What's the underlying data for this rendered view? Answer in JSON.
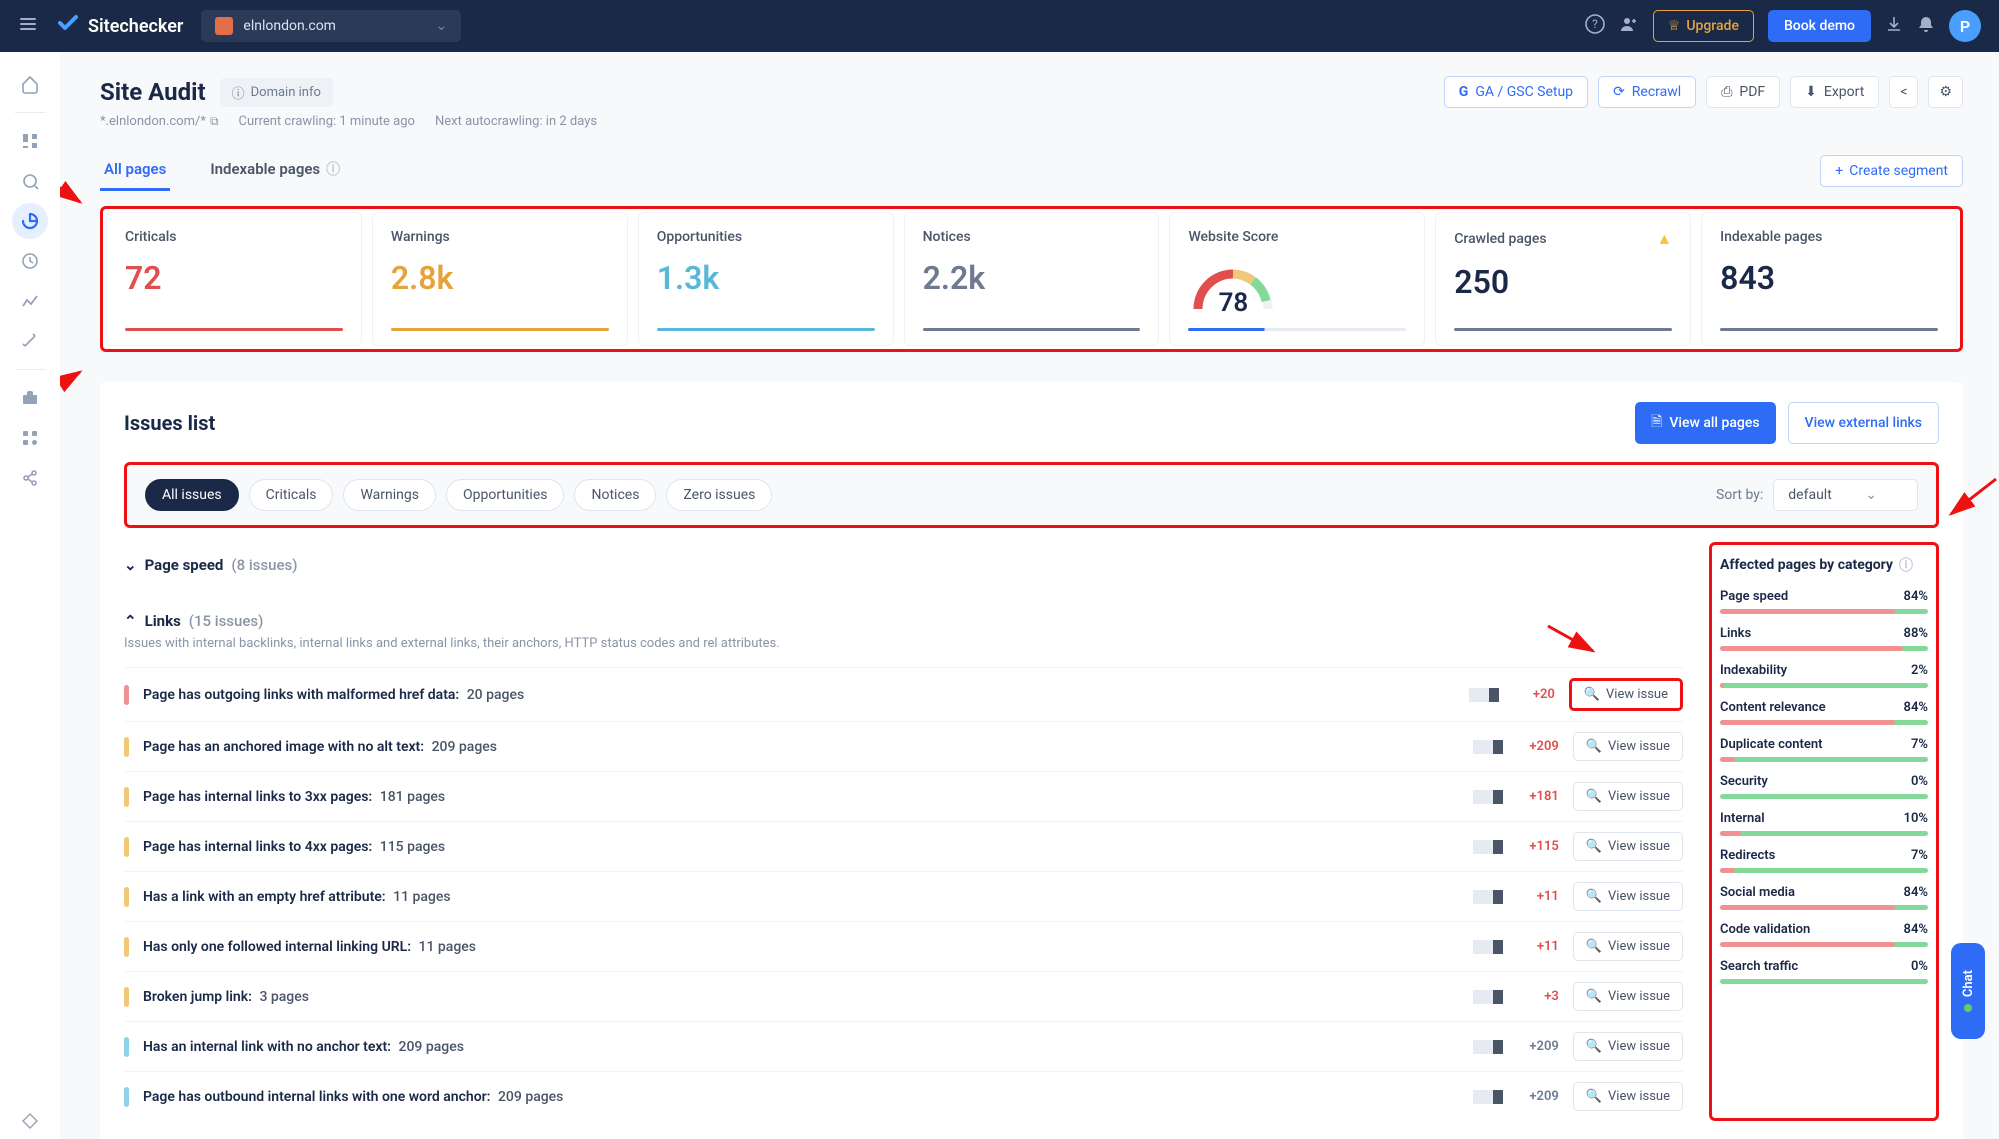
{
  "navbar": {
    "brand": "Sitechecker",
    "site_name": "elnlondon.com",
    "upgrade": "Upgrade",
    "demo": "Book demo",
    "avatar_letter": "P"
  },
  "header": {
    "title": "Site Audit",
    "domain_info": "Domain info",
    "scope": "*.elnlondon.com/*",
    "crawl_status": "Current crawling: 1 minute ago",
    "next_crawl": "Next autocrawling: in 2 days",
    "ga_gsc": "GA / GSC Setup",
    "recrawl": "Recrawl",
    "pdf": "PDF",
    "export": "Export"
  },
  "tabs": {
    "all_pages": "All pages",
    "indexable": "Indexable pages",
    "create_segment": "Create segment"
  },
  "stats": {
    "criticals_label": "Criticals",
    "criticals_value": "72",
    "warnings_label": "Warnings",
    "warnings_value": "2.8k",
    "opportunities_label": "Opportunities",
    "opportunities_value": "1.3k",
    "notices_label": "Notices",
    "notices_value": "2.2k",
    "score_label": "Website Score",
    "score_value": "78",
    "crawled_label": "Crawled pages",
    "crawled_value": "250",
    "indexable_label": "Indexable pages",
    "indexable_value": "843"
  },
  "issues": {
    "title": "Issues list",
    "view_all": "View all pages",
    "view_external": "View external links",
    "sort_label": "Sort by:",
    "sort_value": "default",
    "filters": {
      "all": "All issues",
      "criticals": "Criticals",
      "warnings": "Warnings",
      "opportunities": "Opportunities",
      "notices": "Notices",
      "zero": "Zero issues"
    },
    "cat_speed": "Page speed",
    "cat_speed_count": "(8 issues)",
    "cat_links": "Links",
    "cat_links_count": "(15 issues)",
    "cat_links_desc": "Issues with internal backlinks, internal links and external links, their anchors, HTTP status codes and rel attributes.",
    "view_issue": "View issue",
    "rows": [
      {
        "sev": "red",
        "text": "Page has outgoing links with malformed href data:",
        "pages": "20 pages",
        "delta": "+20",
        "d": "pos"
      },
      {
        "sev": "orange",
        "text": "Page has an anchored image with no alt text:",
        "pages": "209 pages",
        "delta": "+209",
        "d": "pos"
      },
      {
        "sev": "orange",
        "text": "Page has internal links to 3xx pages:",
        "pages": "181 pages",
        "delta": "+181",
        "d": "pos"
      },
      {
        "sev": "orange",
        "text": "Page has internal links to 4xx pages:",
        "pages": "115 pages",
        "delta": "+115",
        "d": "pos"
      },
      {
        "sev": "orange",
        "text": "Has a link with an empty href attribute:",
        "pages": "11 pages",
        "delta": "+11",
        "d": "pos"
      },
      {
        "sev": "orange",
        "text": "Has only one followed internal linking URL:",
        "pages": "11 pages",
        "delta": "+11",
        "d": "pos"
      },
      {
        "sev": "orange",
        "text": "Broken jump link:",
        "pages": "3 pages",
        "delta": "+3",
        "d": "pos"
      },
      {
        "sev": "cyan",
        "text": "Has an internal link with no anchor text:",
        "pages": "209 pages",
        "delta": "+209",
        "d": "neutral"
      },
      {
        "sev": "cyan",
        "text": "Page has outbound internal links with one word anchor:",
        "pages": "209 pages",
        "delta": "+209",
        "d": "neutral"
      }
    ]
  },
  "affected": {
    "title": "Affected pages by category",
    "items": [
      {
        "name": "Page speed",
        "pct": "84%",
        "fill": 84
      },
      {
        "name": "Links",
        "pct": "88%",
        "fill": 88
      },
      {
        "name": "Indexability",
        "pct": "2%",
        "fill": 2
      },
      {
        "name": "Content relevance",
        "pct": "84%",
        "fill": 84
      },
      {
        "name": "Duplicate content",
        "pct": "7%",
        "fill": 7
      },
      {
        "name": "Security",
        "pct": "0%",
        "fill": 0
      },
      {
        "name": "Internal",
        "pct": "10%",
        "fill": 10
      },
      {
        "name": "Redirects",
        "pct": "7%",
        "fill": 7
      },
      {
        "name": "Social media",
        "pct": "84%",
        "fill": 84
      },
      {
        "name": "Code validation",
        "pct": "84%",
        "fill": 84
      },
      {
        "name": "Search traffic",
        "pct": "0%",
        "fill": 0
      }
    ]
  },
  "chat": "Chat"
}
